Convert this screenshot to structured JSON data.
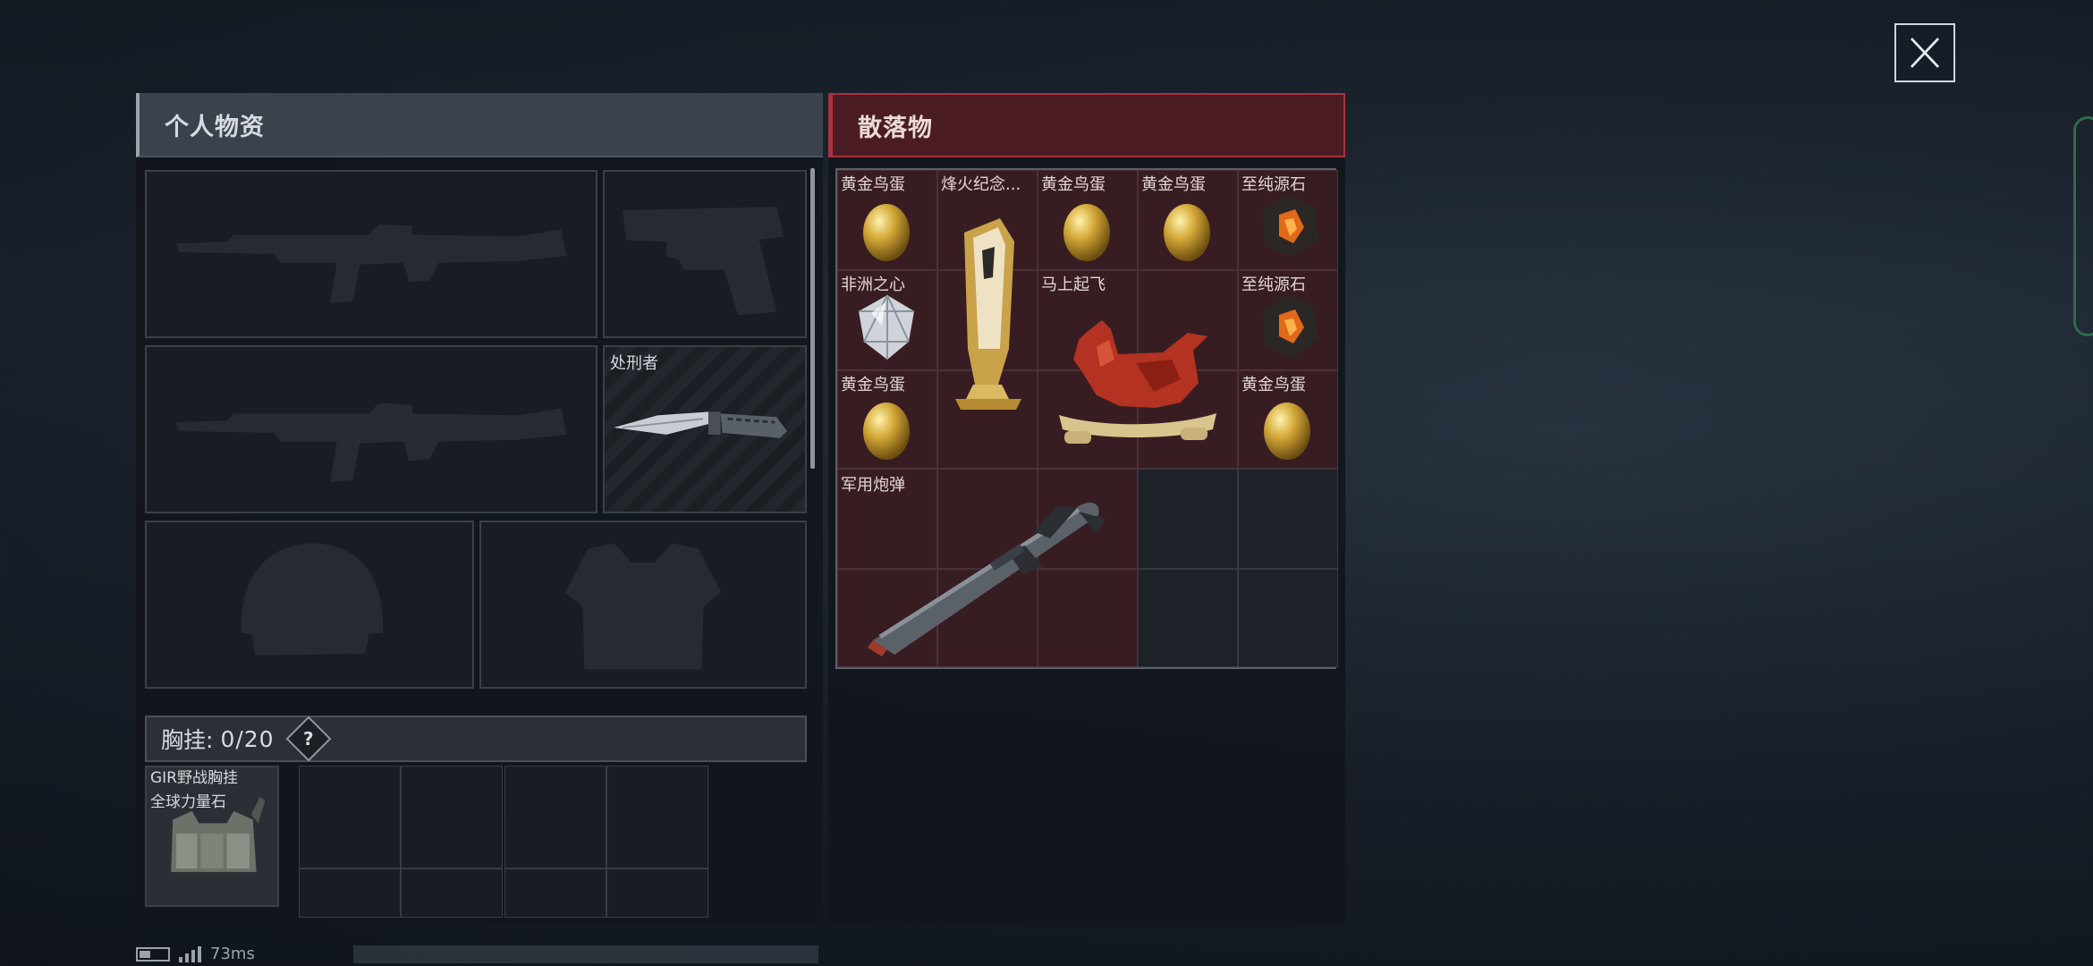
{
  "personal_panel": {
    "title": "个人物资"
  },
  "loot_panel": {
    "title": "散落物"
  },
  "equipment": {
    "melee": {
      "label": "处刑者"
    }
  },
  "chest_rig": {
    "label": "胸挂:",
    "count": "0/20",
    "help": "?",
    "item_name": "GIR野战胸挂",
    "item_sub": "全球力量石"
  },
  "loot_items": [
    {
      "name": "黄金鸟蛋"
    },
    {
      "name": "烽火纪念..."
    },
    {
      "name": "黄金鸟蛋"
    },
    {
      "name": "黄金鸟蛋"
    },
    {
      "name": "至纯源石"
    },
    {
      "name": "非洲之心"
    },
    {
      "name": "马上起飞"
    },
    {
      "name": "至纯源石"
    },
    {
      "name": "黄金鸟蛋"
    },
    {
      "name": "黄金鸟蛋"
    },
    {
      "name": "军用炮弹"
    }
  ],
  "status": {
    "ping": "73ms"
  },
  "colors": {
    "loot_accent": "#a8333f",
    "loot_cell": "#371d22",
    "gold": "#d4a938"
  }
}
